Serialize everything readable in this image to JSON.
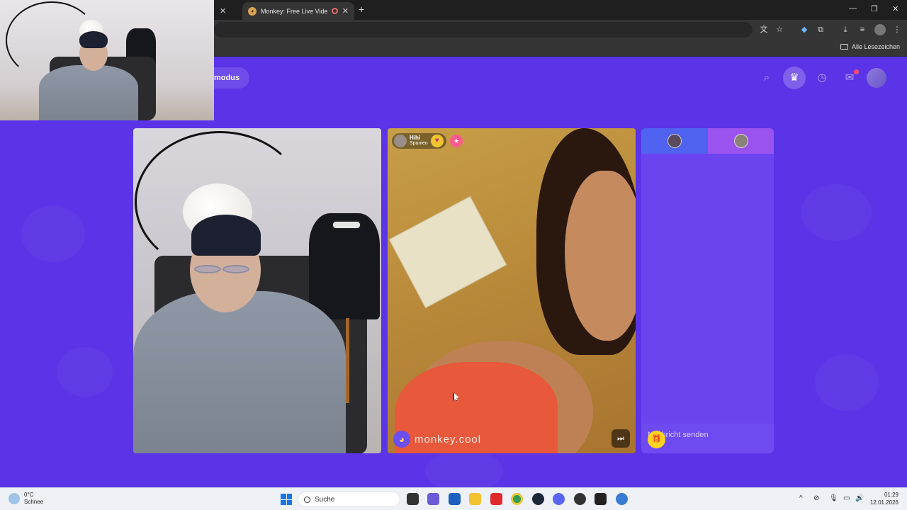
{
  "browser": {
    "active_tab_title": "Monkey: Free Live Video C",
    "new_tab_glyph": "+",
    "bookmarks_all_label": "Alle Lesezeichen"
  },
  "page": {
    "mode_label": "modus",
    "header_icons": [
      "search-icon",
      "crown-icon",
      "history-icon",
      "chat-icon",
      "profile-avatar"
    ],
    "brand_color": "#5a34e6"
  },
  "stranger": {
    "name": "Hihi",
    "country": "Spanien",
    "heart_icon": "heart-icon",
    "watermark": "monkey.cool",
    "skip_icon": "skip-icon"
  },
  "chat": {
    "placeholder": "Nachricht senden",
    "gift_icon": "gift-icon"
  },
  "taskbar": {
    "weather_temp": "0°C",
    "weather_desc": "Schnee",
    "search_label": "Suche",
    "time": "01:29",
    "date": "12.01.2026"
  }
}
